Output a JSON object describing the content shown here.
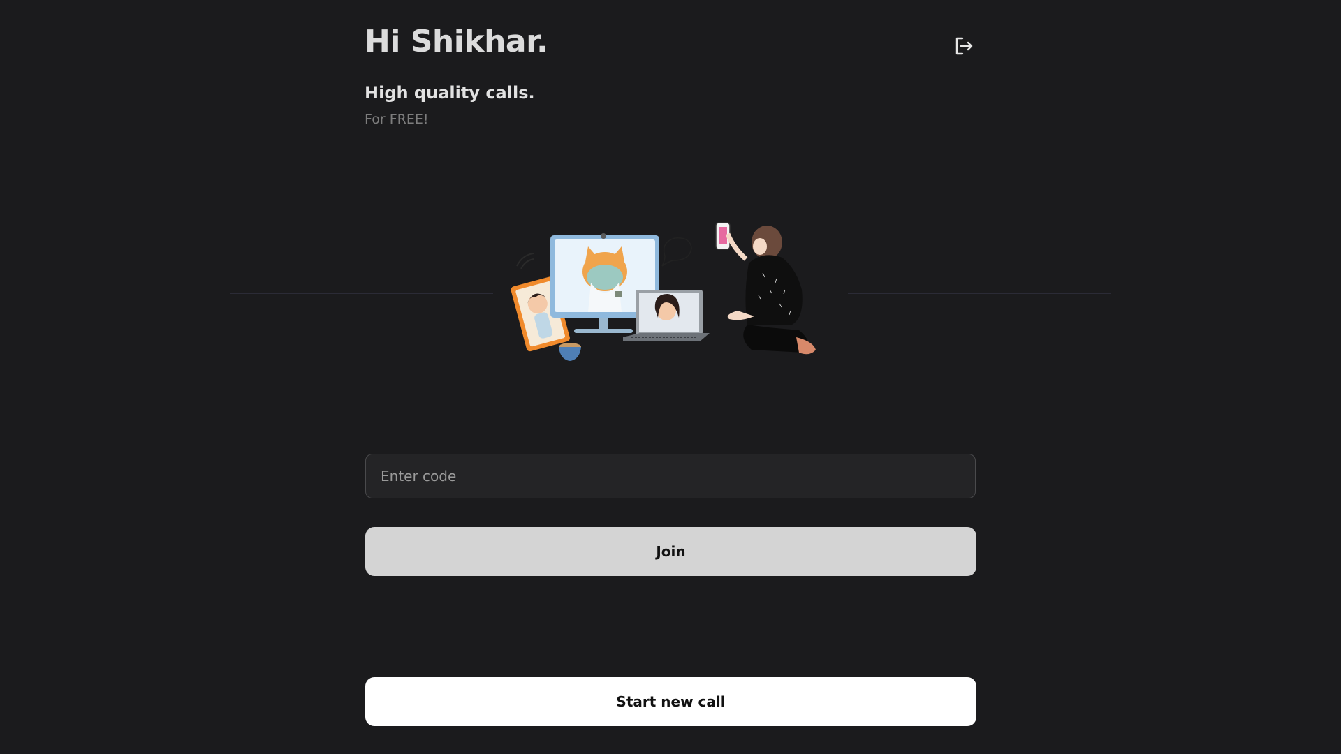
{
  "header": {
    "greeting": "Hi Shikhar.",
    "logout_icon": "logout-icon"
  },
  "hero": {
    "tagline": "High quality calls.",
    "subtagline": "For FREE!"
  },
  "join": {
    "code_placeholder": "Enter code",
    "code_value": "",
    "join_label": "Join"
  },
  "start": {
    "start_label": "Start new call"
  },
  "colors": {
    "background": "#1b1b1d",
    "join_button": "#d4d4d4",
    "start_button": "#ffffff",
    "text_primary": "#dcdcdc",
    "text_muted": "#7d7d7d"
  }
}
